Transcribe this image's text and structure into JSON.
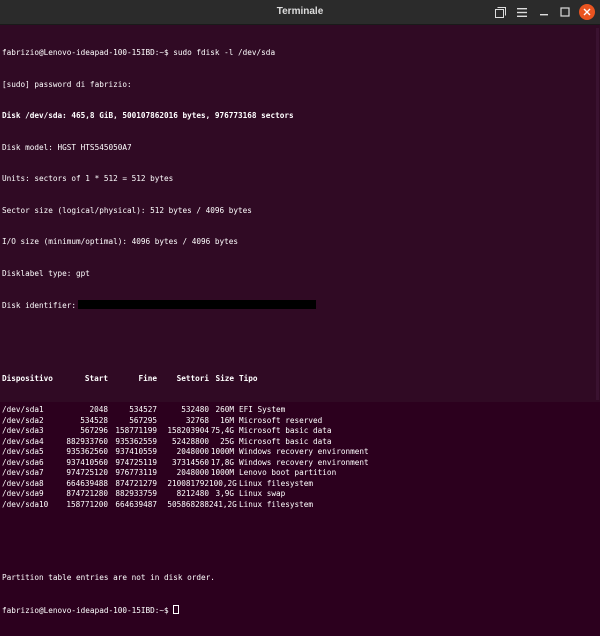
{
  "window": {
    "title": "Terminale",
    "colors": {
      "background": "#300a24",
      "titlebar": "#2b2b2b",
      "close": "#e95420"
    }
  },
  "terminal": {
    "prompt1": "fabrizio@Lenovo-ideapad-100-15IBD:~$ sudo fdisk -l /dev/sda",
    "sudo_line": "[sudo] password di fabrizio:",
    "disk_line": "Disk /dev/sda: 465,8 GiB, 500107862016 bytes, 976773168 sectors",
    "model_line": "Disk model: HGST HTS545050A7",
    "units_line": "Units: sectors of 1 * 512 = 512 bytes",
    "sector_size_line": "Sector size (logical/physical): 512 bytes / 4096 bytes",
    "io_line": "I/O size (minimum/optimal): 4096 bytes / 4096 bytes",
    "label_line": "Disklabel type: gpt",
    "identifier_label": "Disk identifier:",
    "headers": [
      "Dispositivo",
      "Start",
      "Fine",
      "Settori",
      "Size",
      "Tipo"
    ],
    "rows": [
      [
        "/dev/sda1",
        "2048",
        "534527",
        "532480",
        "260M",
        "EFI System"
      ],
      [
        "/dev/sda2",
        "534528",
        "567295",
        "32768",
        "16M",
        "Microsoft reserved"
      ],
      [
        "/dev/sda3",
        "567296",
        "158771199",
        "158203904",
        "75,4G",
        "Microsoft basic data"
      ],
      [
        "/dev/sda4",
        "882933760",
        "935362559",
        "52428800",
        "25G",
        "Microsoft basic data"
      ],
      [
        "/dev/sda5",
        "935362560",
        "937410559",
        "2048000",
        "1000M",
        "Windows recovery environment"
      ],
      [
        "/dev/sda6",
        "937410560",
        "974725119",
        "37314560",
        "17,8G",
        "Windows recovery environment"
      ],
      [
        "/dev/sda7",
        "974725120",
        "976773119",
        "2048000",
        "1000M",
        "Lenovo boot partition"
      ],
      [
        "/dev/sda8",
        "664639488",
        "874721279",
        "210081792",
        "100,2G",
        "Linux filesystem"
      ],
      [
        "/dev/sda9",
        "874721280",
        "882933759",
        "8212480",
        "3,9G",
        "Linux swap"
      ],
      [
        "/dev/sda10",
        "158771200",
        "664639487",
        "505868288",
        "241,2G",
        "Linux filesystem"
      ]
    ],
    "order_note": "Partition table entries are not in disk order.",
    "prompt2": "fabrizio@Lenovo-ideapad-100-15IBD:~$ "
  },
  "icons": [
    "new-tab-icon",
    "menu-icon",
    "minimize-icon",
    "maximize-icon",
    "close-icon"
  ]
}
